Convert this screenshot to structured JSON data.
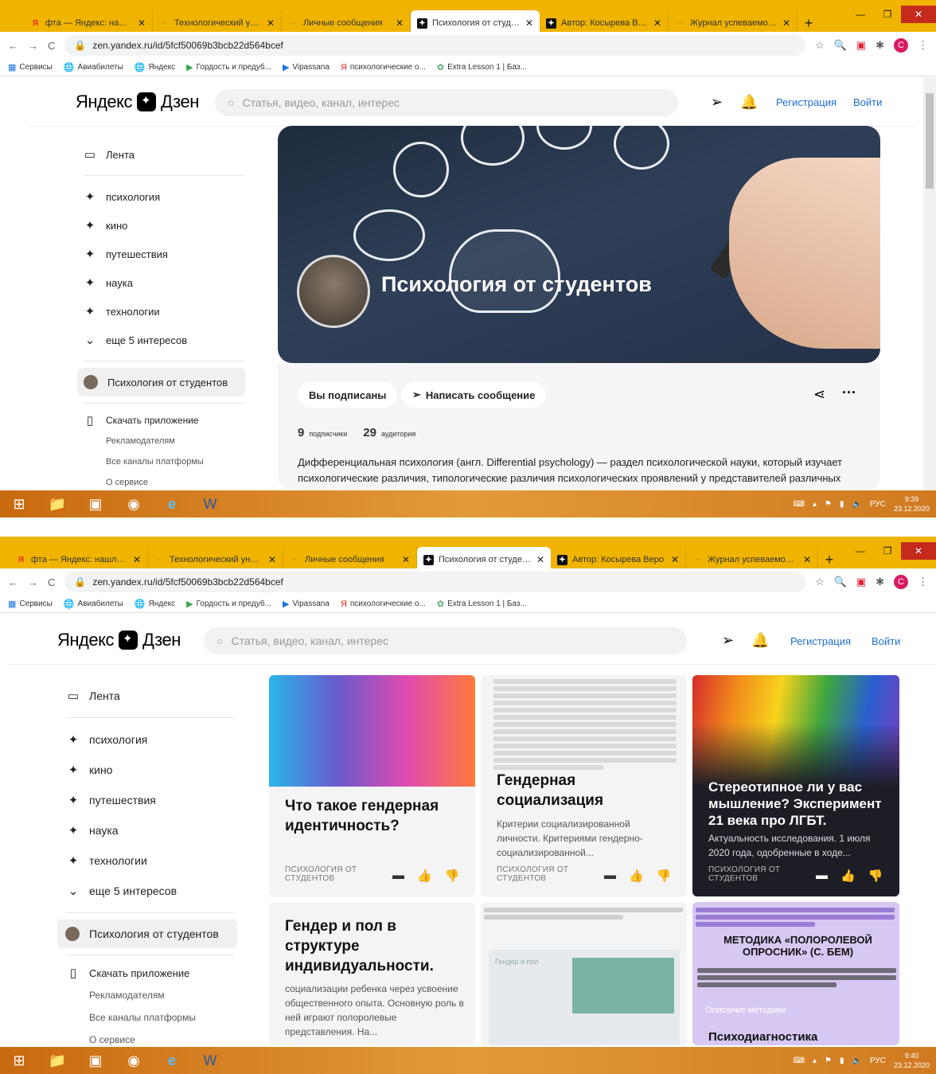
{
  "browser": {
    "tabs": [
      {
        "title": "фта — Яндекс: нашлось",
        "favicon": "yandex-icon",
        "color": "#e52620",
        "glyph": "Я"
      },
      {
        "title": "Технологический униве",
        "favicon": "university-icon",
        "color": "#d98b00",
        "glyph": "~"
      },
      {
        "title": "Личные сообщения",
        "favicon": "messages-icon",
        "color": "#d98b00",
        "glyph": "~"
      },
      {
        "title": "Психология от студенто",
        "favicon": "zen-icon",
        "color": "#111111",
        "glyph": "✦"
      },
      {
        "title": "Автор: Косырева Веро",
        "favicon": "zen-icon",
        "color": "#111111",
        "glyph": "✦"
      },
      {
        "title": "Журнал успеваемости (",
        "favicon": "journal-icon",
        "color": "#d98b00",
        "glyph": "~"
      }
    ],
    "new_tab": "+",
    "url": "zen.yandex.ru/id/5fcf50069b3bcb22d564bcef",
    "bookmarks": [
      {
        "label": "Сервисы",
        "icon": "apps-grid-icon"
      },
      {
        "label": "Авиабилеты",
        "icon": "globe-icon"
      },
      {
        "label": "Яндекс",
        "icon": "globe-icon"
      },
      {
        "label": "Гордость и предуб...",
        "icon": "play-icon"
      },
      {
        "label": "Vipassana",
        "icon": "play-icon"
      },
      {
        "label": "психологические о...",
        "icon": "yandex-icon"
      },
      {
        "label": "Extra Lesson 1 | Баз...",
        "icon": "leaf-icon"
      }
    ],
    "profile_letter": "С"
  },
  "header": {
    "logo_left": "Яндекс",
    "logo_right": "Дзен",
    "search_placeholder": "Статья, видео, канал, интерес",
    "register": "Регистрация",
    "login": "Войти"
  },
  "sidebar": {
    "feed": "Лента",
    "interests": [
      "психология",
      "кино",
      "путешествия",
      "наука",
      "технологии"
    ],
    "more": "еще 5 интересов",
    "channel": "Психология от студентов",
    "download": "Скачать приложение",
    "links": [
      "Рекламодателям",
      "Все каналы платформы",
      "О сервисе"
    ]
  },
  "channel": {
    "title": "Психология от студентов",
    "subscribed_btn": "Вы подписаны",
    "message_btn": "Написать сообщение",
    "subscribers_num": "9",
    "subscribers_label": "подписчики",
    "audience_num": "29",
    "audience_label": "аудитория",
    "description": "Дифференциальная психология (англ. Differential psychology) — раздел психологической науки, который изучает психологические различия, типологические различия психологических проявлений у представителей различных"
  },
  "cards": [
    {
      "title": "Что такое гендерная идентичность?",
      "snippet": "",
      "channel": "ПСИХОЛОГИЯ ОТ СТУДЕНТОВ"
    },
    {
      "title": "Гендерная социализация",
      "snippet": "Критерии социализированной личности. Критериями гендерно-социализированной...",
      "channel": "ПСИХОЛОГИЯ ОТ СТУДЕНТОВ"
    },
    {
      "title": "Стереотипное ли у вас мышление? Эксперимент 21 века про ЛГБТ.",
      "snippet": "Актуальность исследования. 1 июля 2020 года, одобренные в ходе...",
      "channel": "ПСИХОЛОГИЯ ОТ СТУДЕНТОВ"
    },
    {
      "title": "Гендер и пол в структуре индивидуальности.",
      "snippet": "социализации ребенка через усвоение общественного опыта. Основную роль в ней играют полоролевые представления. На...",
      "channel": ""
    },
    {
      "title": "Гендер и пол",
      "snippet": "",
      "channel": ""
    },
    {
      "title": "Психодиагностика маскулинных и",
      "snippet": "МЕТОДИКА «ПОЛОРОЛЕВОЙ ОПРОСНИК» (С. БЕМ)",
      "subtitle": "Описание методики",
      "channel": ""
    }
  ],
  "taskbar": {
    "lang": "РУС",
    "shot1_time": "9:39",
    "shot1_date": "23.12.2020",
    "shot2_time": "9:40",
    "shot2_date": "23.12.2020"
  },
  "colors": {
    "accent": "#1f6dd3",
    "tabbar": "#f0b400",
    "taskbar": "#d07a20"
  }
}
